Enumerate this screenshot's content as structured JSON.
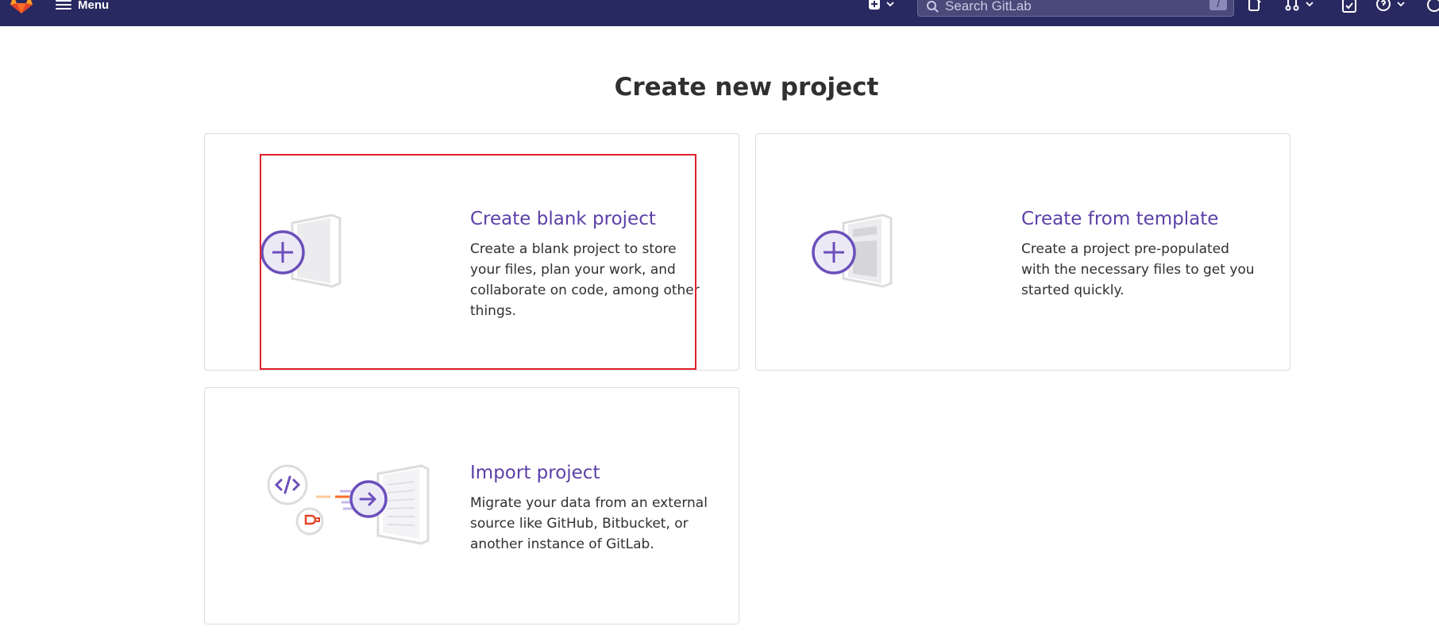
{
  "nav": {
    "menu_label": "Menu",
    "search_placeholder": "Search GitLab",
    "search_shortcut": "/",
    "colors": {
      "bar": "#292961",
      "accent": "#6b4fbb",
      "logo": "#e24329"
    }
  },
  "page": {
    "title": "Create new project"
  },
  "cards": [
    {
      "title": "Create blank project",
      "description": "Create a blank project to store your files, plan your work, and collaborate on code, among other things.",
      "icon": "blank-project-illustration"
    },
    {
      "title": "Create from template",
      "description": "Create a project pre-populated with the necessary files to get you started quickly.",
      "icon": "template-project-illustration"
    },
    {
      "title": "Import project",
      "description": "Migrate your data from an external source like GitHub, Bitbucket, or another instance of GitLab.",
      "icon": "import-project-illustration"
    }
  ]
}
